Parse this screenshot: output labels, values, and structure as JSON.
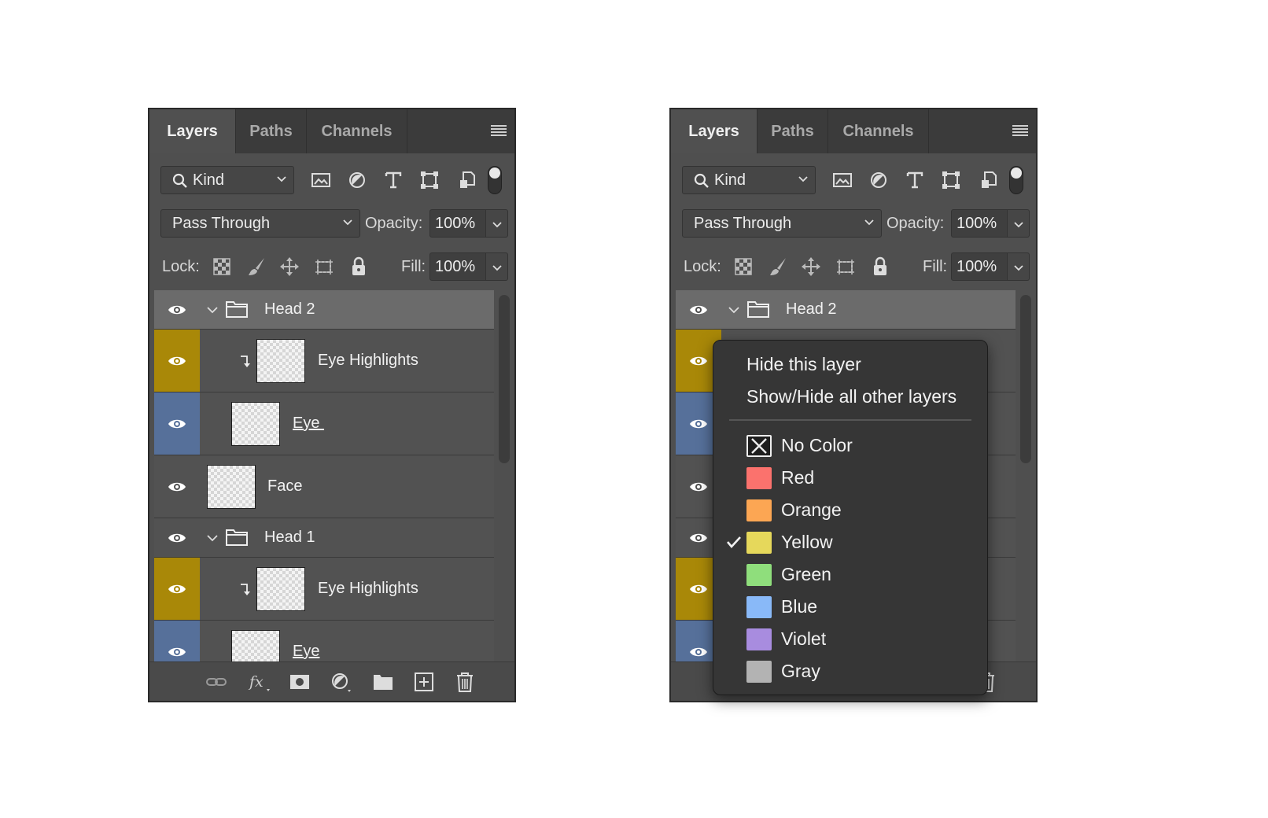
{
  "tabs": [
    "Layers",
    "Paths",
    "Channels"
  ],
  "filter": {
    "kind_label": "Kind"
  },
  "blend": {
    "mode": "Pass Through",
    "opacity_label": "Opacity:",
    "opacity": "100%"
  },
  "lock": {
    "label": "Lock:",
    "fill_label": "Fill:",
    "fill": "100%"
  },
  "layers": [
    {
      "name": "Head 2",
      "type": "group",
      "color": "none",
      "selected": true
    },
    {
      "name": "Eye Highlights",
      "type": "clipped",
      "color": "yellow"
    },
    {
      "name": "Eye ",
      "type": "layer",
      "color": "blue",
      "underline": true
    },
    {
      "name": "Face",
      "type": "layer",
      "color": "none"
    },
    {
      "name": "Head 1",
      "type": "group",
      "color": "none"
    },
    {
      "name": "Eye Highlights",
      "type": "clipped",
      "color": "yellow"
    },
    {
      "name": "Eye",
      "type": "layer",
      "color": "blue",
      "underline": true
    }
  ],
  "context_menu": {
    "hide_layer": "Hide this layer",
    "show_hide_others": "Show/Hide all other layers",
    "colors": [
      {
        "label": "No Color",
        "swatch": "none",
        "checked": false
      },
      {
        "label": "Red",
        "swatch": "#fb726d",
        "checked": false
      },
      {
        "label": "Orange",
        "swatch": "#fca653",
        "checked": false
      },
      {
        "label": "Yellow",
        "swatch": "#e6d85b",
        "checked": true
      },
      {
        "label": "Green",
        "swatch": "#8fde7c",
        "checked": false
      },
      {
        "label": "Blue",
        "swatch": "#89b9f8",
        "checked": false
      },
      {
        "label": "Violet",
        "swatch": "#a88cdf",
        "checked": false
      },
      {
        "label": "Gray",
        "swatch": "#b3b3b3",
        "checked": false
      }
    ]
  },
  "colors": {
    "yellow_label": "#a98808",
    "blue_label": "#56709a",
    "panel_bg": "#4f4f4f",
    "selected_row": "#6b6b6b"
  }
}
